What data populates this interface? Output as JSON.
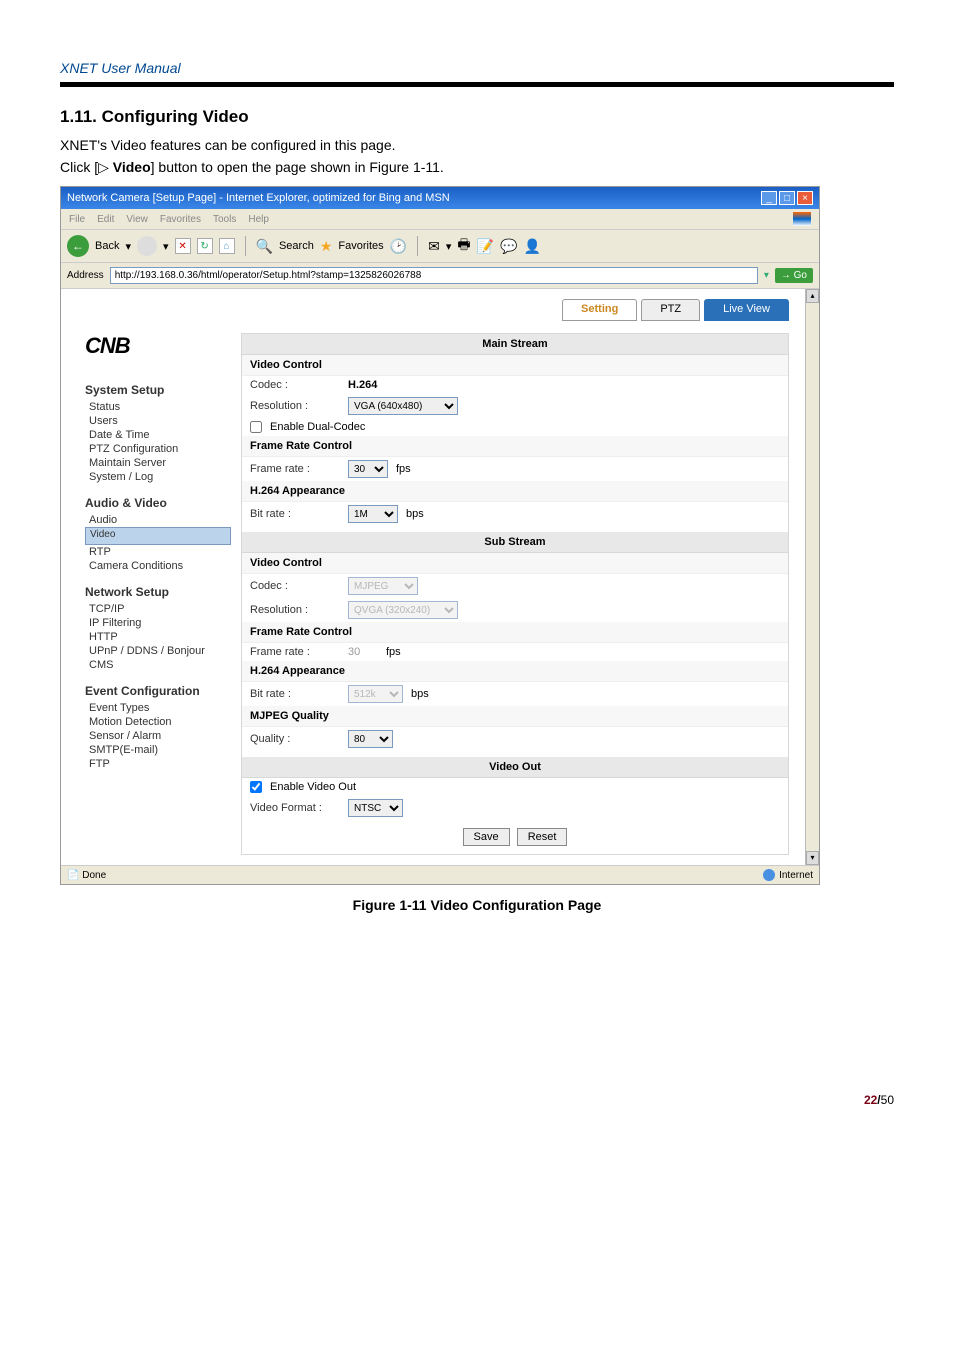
{
  "doc_header": "XNET User Manual",
  "section_title": "1.11. Configuring Video",
  "intro1": "XNET's Video features can be configured in this page.",
  "intro2_pre": "Click [▷ ",
  "intro2_bold": "Video",
  "intro2_post": "] button to open the page shown in Figure 1-11.",
  "titlebar": "Network Camera [Setup Page] - Internet Explorer, optimized for Bing and MSN",
  "ie_menu": [
    "File",
    "Edit",
    "View",
    "Favorites",
    "Tools",
    "Help"
  ],
  "toolbar": {
    "back": "Back",
    "search": "Search",
    "favorites": "Favorites"
  },
  "address_label": "Address",
  "address_value": "http://193.168.0.36/html/operator/Setup.html?stamp=1325826026788",
  "go": "Go",
  "tabs": {
    "setting": "Setting",
    "ptz": "PTZ",
    "live": "Live View"
  },
  "logo": "CNB",
  "sidebar": {
    "g1": "System Setup",
    "g1i": [
      "Status",
      "Users",
      "Date & Time",
      "PTZ Configuration",
      "Maintain Server",
      "System / Log"
    ],
    "g2": "Audio & Video",
    "g2i": [
      "Audio",
      "Video",
      "RTP",
      "Camera Conditions"
    ],
    "g3": "Network Setup",
    "g3i": [
      "TCP/IP",
      "IP Filtering",
      "HTTP",
      "UPnP / DDNS / Bonjour",
      "CMS"
    ],
    "g4": "Event Configuration",
    "g4i": [
      "Event Types",
      "Motion Detection",
      "Sensor / Alarm",
      "SMTP(E-mail)",
      "FTP"
    ]
  },
  "main": {
    "main_stream": "Main Stream",
    "video_control": "Video Control",
    "codec_l": "Codec :",
    "codec_v": "H.264",
    "res_l": "Resolution :",
    "res_v": "VGA (640x480)",
    "enable_dual": "Enable Dual-Codec",
    "frc": "Frame Rate Control",
    "fr_l": "Frame rate :",
    "fr_v": "30",
    "fps": "fps",
    "h264app": "H.264 Appearance",
    "bit_l": "Bit rate :",
    "bit_v": "1M",
    "bps": "bps",
    "sub_stream": "Sub Stream",
    "codec2_v": "MJPEG",
    "res2_v": "QVGA (320x240)",
    "fr2_v": "30",
    "bit2_v": "512k",
    "mjpeg_q": "MJPEG Quality",
    "q_l": "Quality :",
    "q_v": "80",
    "video_out": "Video Out",
    "enable_vo": "Enable Video Out",
    "vf_l": "Video Format :",
    "vf_v": "NTSC",
    "save": "Save",
    "reset": "Reset"
  },
  "status_done": "Done",
  "status_internet": "Internet",
  "figure": "Figure 1-11 Video Configuration Page",
  "page_cur": "22",
  "page_sep": " / ",
  "page_total": "50"
}
